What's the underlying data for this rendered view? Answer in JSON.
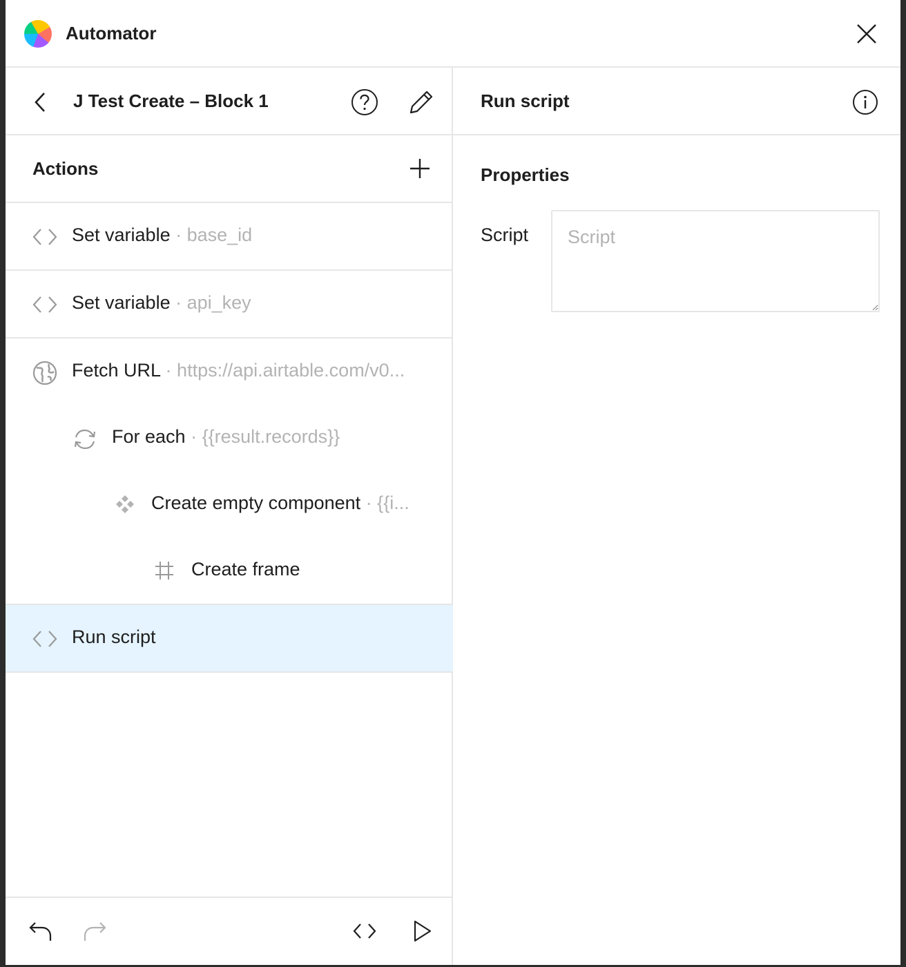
{
  "app": {
    "title": "Automator",
    "logo_icon": "automator-logo-icon"
  },
  "left_pane": {
    "workflow_title": "J Test Create – Block 1",
    "actions_title": "Actions",
    "actions": [
      {
        "name": "Set variable",
        "sep": " · ",
        "detail": "base_id",
        "icon": "code-icon",
        "indent": 0
      },
      {
        "name": "Set variable",
        "sep": " · ",
        "detail": "api_key",
        "icon": "code-icon",
        "indent": 0
      },
      {
        "name": "Fetch URL",
        "sep": " · ",
        "detail": "https://api.airtable.com/v0...",
        "icon": "globe-icon",
        "indent": 0
      },
      {
        "name": "For each",
        "sep": " · ",
        "detail": "{{result.records}}",
        "icon": "loop-icon",
        "indent": 1
      },
      {
        "name": "Create empty component",
        "sep": " · ",
        "detail": "{{i...",
        "icon": "component-icon",
        "indent": 2
      },
      {
        "name": "Create frame",
        "sep": "",
        "detail": "",
        "icon": "frame-icon",
        "indent": 3
      },
      {
        "name": "Run script",
        "sep": "",
        "detail": "",
        "icon": "code-icon",
        "indent": 0,
        "selected": true
      }
    ]
  },
  "right_pane": {
    "title": "Run script",
    "properties_title": "Properties",
    "script_label": "Script",
    "script_placeholder": "Script",
    "script_value": ""
  },
  "colors": {
    "selected_row": "#e5f4ff",
    "border": "#e6e6e6",
    "muted_text": "#b3b3b3",
    "text": "#1e1e1e"
  }
}
